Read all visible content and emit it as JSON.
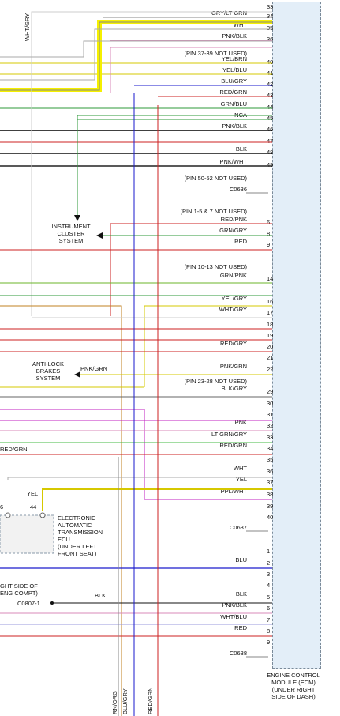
{
  "ecm": {
    "label_lines": [
      "ENGINE CONTROL",
      "MODULE (ECM)",
      "(UNDER RIGHT",
      "SIDE OF DASH)"
    ]
  },
  "connectors": {
    "c0636": {
      "name": "C0636",
      "pins": [
        {
          "pin": "33",
          "label": "",
          "color": ""
        },
        {
          "pin": "34",
          "label": "GRY/LT GRN",
          "color": "#888888"
        },
        {
          "pin": "35",
          "label": "WHT",
          "color": "#aaaaaa"
        },
        {
          "pin": "36",
          "label": "PNK/BLK",
          "color": "#d88ab8"
        },
        {
          "pin": "40",
          "label": "YEL/BRN",
          "color": "#d6c800"
        },
        {
          "pin": "41",
          "label": "YEL/BLU",
          "color": "#d6c800"
        },
        {
          "pin": "42",
          "label": "BLU/GRY",
          "color": "#1a1acc"
        },
        {
          "pin": "43",
          "label": "RED/GRN",
          "color": "#cc2222"
        },
        {
          "pin": "44",
          "label": "GRN/BLU",
          "color": "#2e9a3a"
        },
        {
          "pin": "45",
          "label": "NCA",
          "color": "#2e9a3a"
        },
        {
          "pin": "46",
          "label": "PNK/BLK",
          "color": "#000000"
        },
        {
          "pin": "47",
          "label": "",
          "color": "#cc2222"
        },
        {
          "pin": "48",
          "label": "BLK",
          "color": "#111111"
        },
        {
          "pin": "49",
          "label": "PNK/WHT",
          "color": "#222222"
        }
      ],
      "notes": [
        "(PIN 37-39 NOT USED)",
        "(PIN 50-52 NOT USED)"
      ]
    },
    "c0637": {
      "name": "C0637",
      "pins": [
        {
          "pin": "6",
          "label": "RED/PNK",
          "color": "#cc2222"
        },
        {
          "pin": "8",
          "label": "GRN/GRY",
          "color": "#2e9a3a"
        },
        {
          "pin": "9",
          "label": "RED",
          "color": "#cc2222"
        },
        {
          "pin": "14",
          "label": "GRN/PNK",
          "color": "#6bb52a"
        },
        {
          "pin": "16",
          "label": "YEL/GRY",
          "color": "#2e9a3a"
        },
        {
          "pin": "17",
          "label": "WHT/GRY",
          "color": "#cc2222"
        },
        {
          "pin": "18",
          "label": "",
          "color": "#aaaaaa"
        },
        {
          "pin": "19",
          "label": "",
          "color": ""
        },
        {
          "pin": "20",
          "label": "RED/GRY",
          "color": "#cc2222"
        },
        {
          "pin": "21",
          "label": "",
          "color": "#cc2222"
        },
        {
          "pin": "22",
          "label": "PNK/GRN",
          "color": "#d6c800"
        },
        {
          "pin": "29",
          "label": "BLK/GRY",
          "color": "#666666"
        },
        {
          "pin": "30",
          "label": "",
          "color": "#c020c0"
        },
        {
          "pin": "31",
          "label": "",
          "color": "#c020c0"
        },
        {
          "pin": "32",
          "label": "PNK",
          "color": "#d88ab8"
        },
        {
          "pin": "33",
          "label": "LT GRN/GRY",
          "color": "#44bb44"
        },
        {
          "pin": "34",
          "label": "RED/GRN",
          "color": "#cc2222"
        },
        {
          "pin": "35",
          "label": "",
          "color": "#2e9a3a"
        },
        {
          "pin": "36",
          "label": "WHT",
          "color": "#aaaaaa"
        },
        {
          "pin": "37",
          "label": "YEL",
          "color": "#d6c800"
        },
        {
          "pin": "38",
          "label": "PPL/WHT",
          "color": "#c020c0"
        },
        {
          "pin": "39",
          "label": "",
          "color": ""
        },
        {
          "pin": "40",
          "label": "",
          "color": ""
        }
      ],
      "notes": [
        "(PIN 1-5 & 7 NOT USED)",
        "(PIN 10-13 NOT USED)",
        "(PIN 23-28 NOT USED)"
      ]
    },
    "c0638": {
      "name": "C0638",
      "pins": [
        {
          "pin": "1",
          "label": "",
          "color": ""
        },
        {
          "pin": "2",
          "label": "BLU",
          "color": "#1a1acc"
        },
        {
          "pin": "3",
          "label": "",
          "color": ""
        },
        {
          "pin": "4",
          "label": "",
          "color": ""
        },
        {
          "pin": "5",
          "label": "BLK",
          "color": "#111111"
        },
        {
          "pin": "6",
          "label": "PNK/BLK",
          "color": "#d88ab8"
        },
        {
          "pin": "7",
          "label": "WHT/BLU",
          "color": "#9999dd"
        },
        {
          "pin": "8",
          "label": "RED",
          "color": "#cc2222"
        },
        {
          "pin": "9",
          "label": "",
          "color": ""
        }
      ]
    }
  },
  "components": {
    "instrument_cluster": [
      "INSTRUMENT",
      "CLUSTER",
      "SYSTEM"
    ],
    "anti_lock": [
      "ANTI-LOCK",
      "BRAKES",
      "SYSTEM"
    ],
    "anti_lock_wire": "PNK/GRN",
    "tcu": [
      "ELECTRONIC",
      "AUTOMATIC",
      "TRANSMISSION",
      "ECU",
      "(UNDER LEFT",
      "FRONT SEAT)"
    ],
    "tcu_pin_a": "6",
    "tcu_pin_b": "44",
    "tcu_wire": "YEL",
    "ground_note": [
      "GHT SIDE OF",
      "ENG COMPT)"
    ],
    "ground_connector": "C0807-1",
    "ground_wire": "BLK",
    "left_wire_label": "RED/GRN"
  },
  "vertical_labels": {
    "top_left": "WHT/GRY",
    "bottom": [
      "RN/ORG",
      "BLU/GRY",
      "RED/GRN"
    ]
  }
}
